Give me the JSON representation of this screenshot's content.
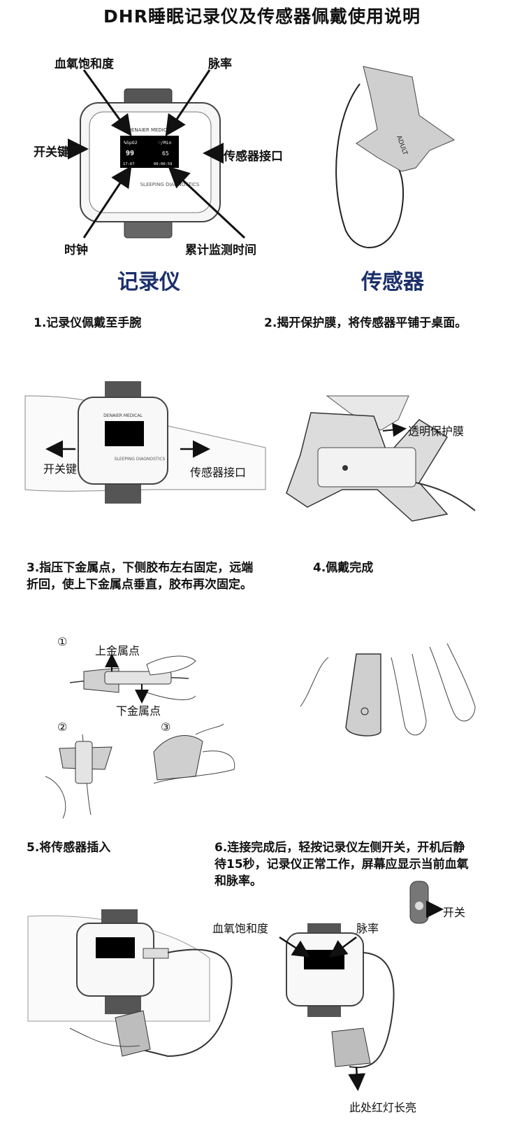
{
  "title": "DHR睡眠记录仪及传感器佩戴使用说明",
  "diagram": {
    "spo2_label": "血氧饱和度",
    "pulse_label": "脉率",
    "power_key_label": "开关键",
    "sensor_port_label": "传感器接口",
    "clock_label": "时钟",
    "cumulative_time_label": "累计监测时间",
    "recorder_caption": "记录仪",
    "sensor_caption": "传感器",
    "device_brand": "DENAIER MEDICAL",
    "device_subtitle": "SLEEPING DIAGNOSTICS",
    "screen": {
      "spo2_head": "%SpO2",
      "pulse_head": "♡/Min",
      "spo2_value": "99",
      "pulse_value": "65",
      "clock": "17:07",
      "elapsed": "00:00:59"
    },
    "sensor_tag": "ADULT"
  },
  "steps": [
    {
      "text": "1.记录仪佩戴至手腕",
      "labels": [
        "开关键",
        "传感器接口"
      ]
    },
    {
      "text": "2.揭开保护膜，将传感器平铺于桌面。",
      "labels": [
        "透明保护膜"
      ]
    },
    {
      "text": "3.指压下金属点，下侧胶布左右固定，远端折回，使上下金属点垂直，胶布再次固定。",
      "labels": [
        "①",
        "上金属点",
        "下金属点",
        "②",
        "③"
      ]
    },
    {
      "text": "4.佩戴完成",
      "labels": []
    },
    {
      "text": "5.将传感器插入",
      "labels": []
    },
    {
      "text": "6.连接完成后，轻按记录仪左侧开关，开机后静待15秒，记录仪正常工作，屏幕应显示当前血氧和脉率。",
      "labels": [
        "开关",
        "血氧饱和度",
        "脉率",
        "此处红灯长亮"
      ]
    }
  ],
  "colors": {
    "caption_blue": "#1b2f6b",
    "ink": "#111111"
  }
}
